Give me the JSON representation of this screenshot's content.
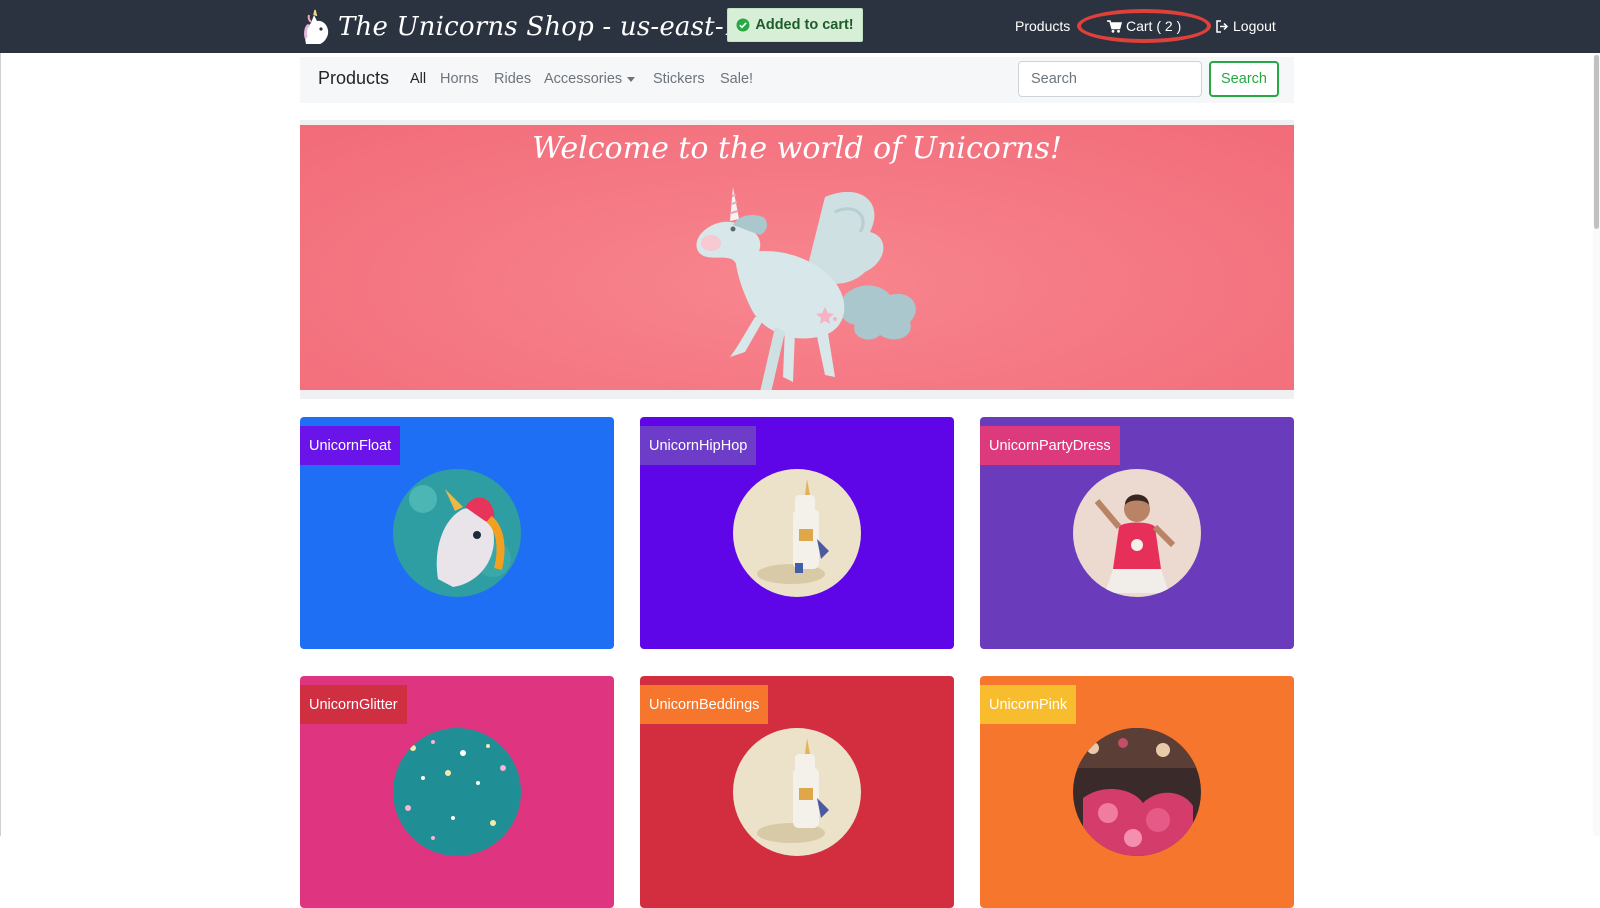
{
  "header": {
    "brand_title": "The Unicorns Shop - us-east-1",
    "toast": "Added to cart!",
    "nav_products": "Products",
    "cart_label": "Cart ( 2 )",
    "logout_label": "Logout"
  },
  "subnav": {
    "title": "Products",
    "categories": [
      "All",
      "Horns",
      "Rides",
      "Accessories",
      "Stickers",
      "Sale!"
    ],
    "search_placeholder": "Search",
    "search_button": "Search"
  },
  "hero": {
    "title": "Welcome to the world of Unicorns!"
  },
  "products": [
    {
      "name": "UnicornFloat",
      "bg": "#1f6ff5",
      "label_bg": "#6a14ea"
    },
    {
      "name": "UnicornHipHop",
      "bg": "#5f06e8",
      "label_bg": "#6d3cc8"
    },
    {
      "name": "UnicornPartyDress",
      "bg": "#6a3cbb",
      "label_bg": "#dd3a7d"
    },
    {
      "name": "UnicornGlitter",
      "bg": "#df3580",
      "label_bg": "#d02f42"
    },
    {
      "name": "UnicornBeddings",
      "bg": "#d22e3f",
      "label_bg": "#f5762c"
    },
    {
      "name": "UnicornPink",
      "bg": "#f7762d",
      "label_bg": "#f7bd2e"
    }
  ],
  "colors": {
    "topbar": "#2b3340",
    "success": "#28a745",
    "highlight_ring": "#e0403a"
  }
}
